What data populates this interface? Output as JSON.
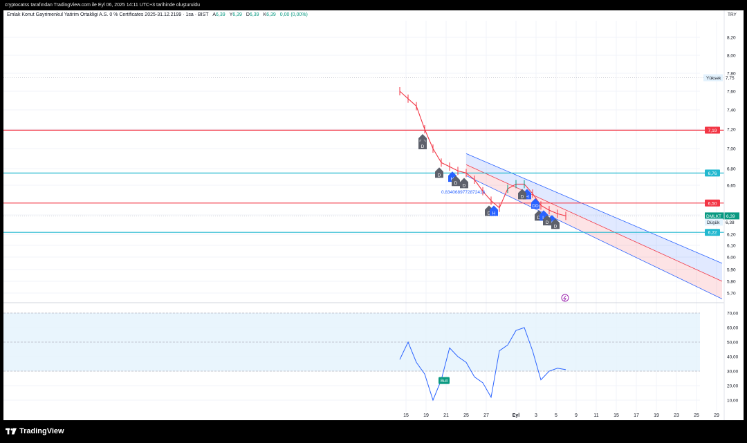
{
  "header": {
    "caption": "cryptocatss tarafından TradingView.com ile Eyl 06, 2025 14:11 UTC+3 tarihinde oluşturuldu"
  },
  "symbol": {
    "name": "Emlak Konut Gayrimenkul Yatirim Ortakligi A.S. 0 % Certificates 2025-31.12.2199 · 1sa · BIST",
    "open_label": "A",
    "open": "6,39",
    "high_label": "Y",
    "high": "6,39",
    "low_label": "D",
    "low": "6,39",
    "close_label": "K",
    "close": "6,39",
    "change": "0,00 (0,00%)",
    "currency": "TRY"
  },
  "brand": {
    "name": "TradingView"
  },
  "colors": {
    "up": "#089981",
    "down": "#f23645",
    "cyan": "#22b8cf",
    "red_line": "#f23645",
    "channel_blue": "#2962ff",
    "rsi_line": "#2962ff",
    "rsi_band": "#e3f2fd"
  },
  "chart_data": [
    {
      "type": "line",
      "title": "Price (candlestick, 1h)",
      "x": [
        "15",
        "16",
        "17",
        "18",
        "19",
        "20",
        "21",
        "22",
        "23",
        "24",
        "25",
        "26",
        "27",
        "28",
        "29",
        "Eyl",
        "2",
        "3",
        "4",
        "5",
        "6"
      ],
      "series": [
        {
          "name": "DMLKT",
          "values": [
            7.6,
            7.52,
            7.44,
            7.2,
            7.0,
            6.86,
            6.82,
            6.78,
            6.76,
            6.7,
            6.6,
            6.52,
            6.46,
            6.62,
            6.66,
            6.66,
            6.58,
            6.48,
            6.44,
            6.41,
            6.39
          ]
        }
      ],
      "y_ticks": [
        "8,20",
        "8,00",
        "7,80",
        "7,60",
        "7,40",
        "7,20",
        "7,00",
        "6,80",
        "6,65",
        "6,40",
        "6,20",
        "6,10",
        "6,00",
        "5,90",
        "5,80",
        "5,70"
      ],
      "x_ticks": [
        "15",
        "19",
        "21",
        "25",
        "27",
        "Eyl",
        "3",
        "5",
        "9",
        "11",
        "15",
        "17",
        "19",
        "23",
        "25",
        "29"
      ],
      "horizontal_lines": [
        {
          "value": 7.19,
          "label": "7,19",
          "color": "#f23645"
        },
        {
          "value": 6.76,
          "label": "6,76",
          "color": "#22b8cf"
        },
        {
          "value": 6.5,
          "label": "6,50",
          "color": "#f23645"
        },
        {
          "value": 6.22,
          "label": "6,22",
          "color": "#22b8cf"
        }
      ],
      "price_labels": [
        {
          "text": "Yüksek",
          "value": "7,75"
        },
        {
          "text": "DMLKT",
          "value": "6,39"
        },
        {
          "text": "Düşük",
          "value": "6,38"
        }
      ],
      "annotations": [
        "0.8340689772872416"
      ],
      "markers": [
        {
          "x": "18",
          "text": "DD",
          "kind": "down"
        },
        {
          "x": "18",
          "text": "D",
          "kind": "down"
        },
        {
          "x": "20",
          "text": "D",
          "kind": "down"
        },
        {
          "x": "21",
          "text": "H",
          "kind": "up"
        },
        {
          "x": "22",
          "text": "D",
          "kind": "down"
        },
        {
          "x": "23",
          "text": "D",
          "kind": "down"
        },
        {
          "x": "26",
          "text": "D",
          "kind": "down"
        },
        {
          "x": "26",
          "text": "H",
          "kind": "up"
        },
        {
          "x": "Eyl",
          "text": "H",
          "kind": "up"
        },
        {
          "x": "Eyl",
          "text": "D",
          "kind": "down"
        },
        {
          "x": "2",
          "text": "DD",
          "kind": "up"
        },
        {
          "x": "3",
          "text": "D",
          "kind": "down"
        },
        {
          "x": "3",
          "text": "L",
          "kind": "up"
        },
        {
          "x": "4",
          "text": "DD",
          "kind": "up"
        },
        {
          "x": "4",
          "text": "D",
          "kind": "down"
        },
        {
          "x": "5",
          "text": "D",
          "kind": "down"
        }
      ],
      "regression_channel": {
        "start": "25",
        "end": "29",
        "upper_end": 5.95,
        "mid_end": 5.8,
        "lower_end": 5.65
      }
    },
    {
      "type": "line",
      "title": "RSI",
      "x": [
        "15",
        "16",
        "17",
        "18",
        "19",
        "20",
        "21",
        "22",
        "23",
        "24",
        "25",
        "26",
        "27",
        "28",
        "29",
        "Eyl",
        "2",
        "3",
        "4",
        "5",
        "6"
      ],
      "series": [
        {
          "name": "RSI",
          "values": [
            38,
            50,
            36,
            28,
            10,
            24,
            46,
            40,
            36,
            26,
            22,
            12,
            44,
            48,
            58,
            60,
            44,
            24,
            30,
            32,
            31
          ]
        }
      ],
      "y_ticks": [
        "70,00",
        "60,00",
        "50,00",
        "40,00",
        "30,00",
        "20,00",
        "10,00"
      ],
      "band": [
        30,
        70
      ],
      "annotations": [
        "Bull"
      ]
    }
  ]
}
